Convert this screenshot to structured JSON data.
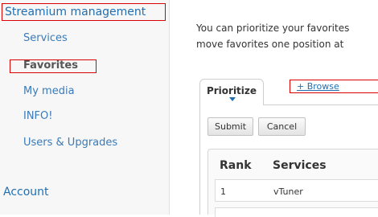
{
  "sidebar": {
    "heading": "Streamium management",
    "items": [
      {
        "label": "Services"
      },
      {
        "label": "Favorites"
      },
      {
        "label": "My media"
      },
      {
        "label": "INFO!"
      },
      {
        "label": "Users & Upgrades"
      }
    ],
    "account": "Account"
  },
  "main": {
    "description_line1": "You can prioritize your favorites",
    "description_line2": "move favorites one position at",
    "tabs": [
      {
        "label": "Prioritize"
      },
      {
        "label": "+ Browse"
      }
    ],
    "buttons": {
      "submit": "Submit",
      "cancel": "Cancel"
    },
    "table": {
      "columns": [
        "Rank",
        "Services"
      ],
      "rows": [
        {
          "rank": "1",
          "service": "vTuner"
        }
      ]
    }
  },
  "colors": {
    "link": "#1f6fb2",
    "highlight_border": "#d90000"
  }
}
